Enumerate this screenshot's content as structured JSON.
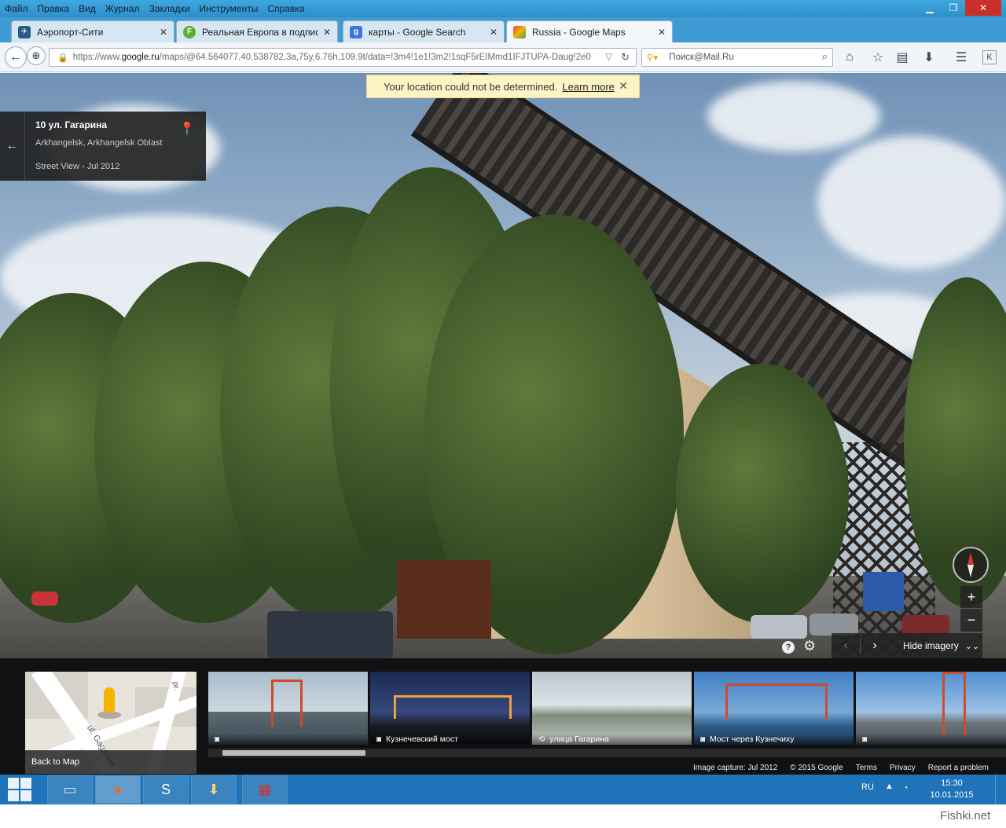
{
  "menu": [
    "Файл",
    "Правка",
    "Вид",
    "Журнал",
    "Закладки",
    "Инструменты",
    "Справка"
  ],
  "tabs": [
    {
      "label": "Аэропорт-Сити",
      "icon": "plane-icon",
      "color": "#2b5b84"
    },
    {
      "label": "Реальная Европа в подпис...",
      "icon": "F",
      "color": "#5ab030"
    },
    {
      "label": "карты - Google Search",
      "icon": "g",
      "color": "#3a78d8"
    },
    {
      "label": "Russia - Google Maps",
      "icon": "maps-icon",
      "color": "#e0473a"
    }
  ],
  "url": {
    "prefix": "https://www.",
    "domain": "google.ru",
    "rest": "/maps/@64.564077,40.538782,3a,75y,6.76h,109.9t/data=!3m4!1e1!3m2!1sqF5rEIMmd1IFJTUPA-Daug!2e0"
  },
  "search": {
    "placeholder": "Поиск@Mail.Ru"
  },
  "notice": {
    "text": "Your location could not be determined.",
    "link": "Learn more"
  },
  "location_card": {
    "address": "10 ул. Гагарина",
    "city": "Arkhangelsk, Arkhangelsk Oblast",
    "date": "Street View - Jul 2012"
  },
  "imagery_nav": {
    "hide_label": "Hide imagery"
  },
  "minimap": {
    "back_label": "Back to Map",
    "street": "ul. Gagarina",
    "street2": "pr."
  },
  "thumbnails": [
    {
      "caption": "",
      "icon": "camera-icon"
    },
    {
      "caption": "Кузнечевский мост",
      "icon": "camera-icon"
    },
    {
      "caption": "улица Гагарина",
      "icon": "360-icon"
    },
    {
      "caption": "Мост через Кузнечиху",
      "icon": "camera-icon"
    },
    {
      "caption": "",
      "icon": "camera-icon"
    }
  ],
  "footer": [
    "Image capture: Jul 2012",
    "© 2015 Google",
    "Terms",
    "Privacy",
    "Report a problem"
  ],
  "taskbar": {
    "lang": "RU",
    "time": "15:30",
    "date": "10.01.2015"
  },
  "watermark": "Fishki.net"
}
